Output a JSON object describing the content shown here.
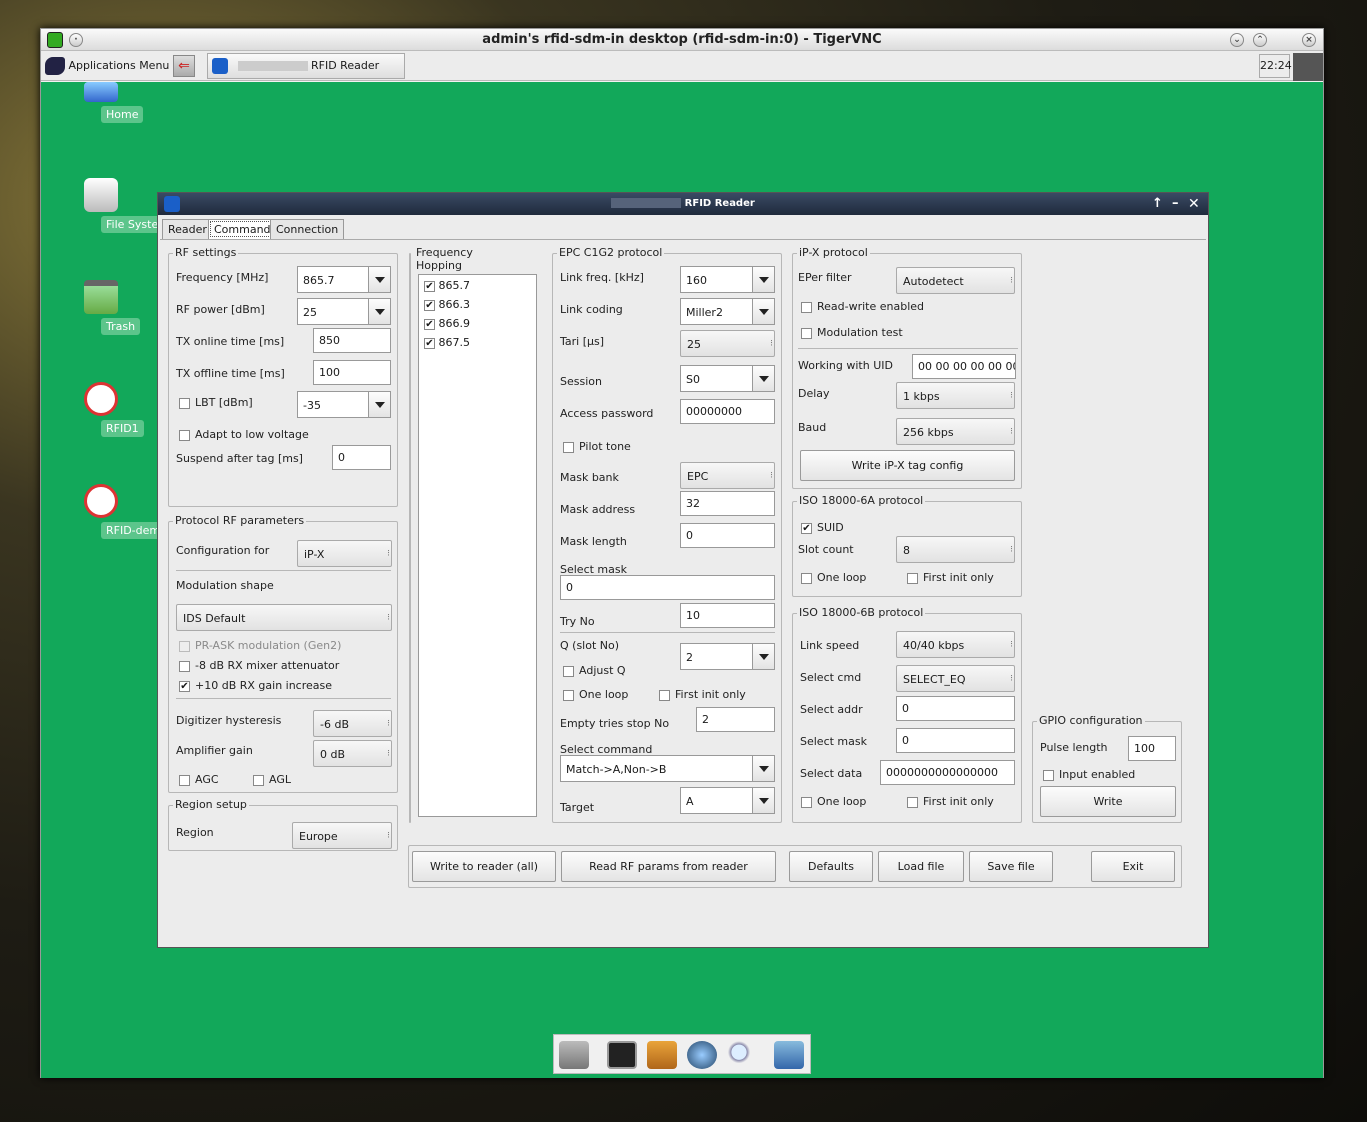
{
  "vnc": {
    "title": "admin's rfid-sdm-in desktop (rfid-sdm-in:0) - TigerVNC"
  },
  "panel": {
    "apps_menu": "Applications Menu",
    "task": "RFID Reader",
    "clock": "22:24"
  },
  "desktop": {
    "icons": [
      "Home",
      "File System",
      "Trash",
      "RFID1",
      "RFID-demo"
    ]
  },
  "app": {
    "title": "RFID Reader",
    "tabs": [
      "Reader",
      "Command",
      "Connection"
    ],
    "active_tab": "Command"
  },
  "rf": {
    "title": "RF settings",
    "freq_label": "Frequency [MHz]",
    "freq": "865.7",
    "power_label": "RF power [dBm]",
    "power": "25",
    "tx_on_label": "TX online time [ms]",
    "tx_on": "850",
    "tx_off_label": "TX offline time [ms]",
    "tx_off": "100",
    "lbt_label": "LBT [dBm]",
    "lbt": "-35",
    "adapt_label": "Adapt to low voltage",
    "suspend_label": "Suspend after tag [ms]",
    "suspend": "0"
  },
  "proto_rf": {
    "title": "Protocol RF parameters",
    "config_label": "Configuration for",
    "config": "iP-X",
    "mod_label": "Modulation shape",
    "mod": "IDS Default",
    "prask": "PR-ASK modulation (Gen2)",
    "mixer": "-8 dB RX mixer attenuator",
    "gain": "+10 dB RX gain increase",
    "dig_label": "Digitizer hysteresis",
    "dig": "-6 dB",
    "amp_label": "Amplifier gain",
    "amp": "0 dB",
    "agc": "AGC",
    "agl": "AGL"
  },
  "region": {
    "title": "Region setup",
    "label": "Region",
    "value": "Europe"
  },
  "hop": {
    "title": "Frequency Hopping",
    "items": [
      "865.7",
      "866.3",
      "866.9",
      "867.5"
    ]
  },
  "epc": {
    "title": "EPC C1G2 protocol",
    "link_freq_label": "Link freq. [kHz]",
    "link_freq": "160",
    "coding_label": "Link coding",
    "coding": "Miller2",
    "tari_label": "Tari [µs]",
    "tari": "25",
    "session_label": "Session",
    "session": "S0",
    "pwd_label": "Access password",
    "pwd": "00000000",
    "pilot": "Pilot tone",
    "bank_label": "Mask bank",
    "bank": "EPC",
    "addr_label": "Mask address",
    "addr": "32",
    "len_label": "Mask length",
    "len": "0",
    "selmask_label": "Select mask",
    "selmask": "0",
    "try_label": "Try No",
    "try": "10",
    "q_label": "Q (slot No)",
    "q": "2",
    "adjust": "Adjust Q",
    "oneloop": "One loop",
    "firstinit": "First init only",
    "empty_label": "Empty tries stop No",
    "empty": "2",
    "selcmd_label": "Select command",
    "selcmd": "Match->A,Non->B",
    "target_label": "Target",
    "target": "A"
  },
  "ipx": {
    "title": "iP-X protocol",
    "eper_label": "EPer filter",
    "eper": "Autodetect",
    "rw": "Read-write enabled",
    "modtest": "Modulation test",
    "uid_label": "Working with UID",
    "uid": "00 00 00 00 00 00 0",
    "delay_label": "Delay",
    "delay": "1 kbps",
    "baud_label": "Baud",
    "baud": "256 kbps",
    "write_btn": "Write iP-X tag config"
  },
  "iso6a": {
    "title": "ISO 18000-6A protocol",
    "suid": "SUID",
    "slot_label": "Slot count",
    "slot": "8",
    "oneloop": "One loop",
    "firstinit": "First init only"
  },
  "iso6b": {
    "title": "ISO 18000-6B protocol",
    "speed_label": "Link speed",
    "speed": "40/40 kbps",
    "cmd_label": "Select cmd",
    "cmd": "SELECT_EQ",
    "addr_label": "Select addr",
    "addr": "0",
    "mask_label": "Select mask",
    "mask": "0",
    "data_label": "Select data",
    "data": "0000000000000000",
    "oneloop": "One loop",
    "firstinit": "First init only"
  },
  "gpio": {
    "title": "GPIO configuration",
    "pulse_label": "Pulse length",
    "pulse": "100",
    "input": "Input enabled",
    "write": "Write"
  },
  "actions": {
    "write_all": "Write to reader (all)",
    "read_rf": "Read RF params from reader",
    "defaults": "Defaults",
    "load": "Load file",
    "save": "Save file",
    "exit": "Exit"
  }
}
